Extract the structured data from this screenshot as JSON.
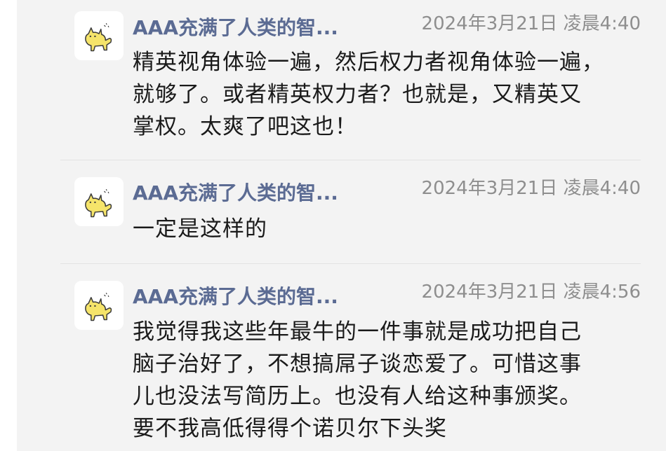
{
  "messages": [
    {
      "sender": "AAA充满了人类的智...",
      "time": "2024年3月21日 凌晨4:40",
      "text": "精英视角体验一遍，然后权力者视角体验一遍，\n就够了。或者精英权力者？也就是，又精英又\n掌权。太爽了吧这也！",
      "avatar_icon": "yellow-cat-icon"
    },
    {
      "sender": "AAA充满了人类的智...",
      "time": "2024年3月21日 凌晨4:40",
      "text": "一定是这样的",
      "avatar_icon": "yellow-cat-icon"
    },
    {
      "sender": "AAA充满了人类的智...",
      "time": "2024年3月21日 凌晨4:56",
      "text": "我觉得我这些年最牛的一件事就是成功把自己\n脑子治好了，不想搞屌子谈恋爱了。可惜这事\n儿也没法写简历上。也没有人给这种事颁奖。\n要不我高低得得个诺贝尔下头奖",
      "avatar_icon": "yellow-cat-icon"
    }
  ],
  "colors": {
    "background": "#f3f3f3",
    "sender_name": "#5b6b93",
    "timestamp": "#8e8e8e",
    "text": "#1a1a1a",
    "avatar_cat": "#f5e46a"
  }
}
